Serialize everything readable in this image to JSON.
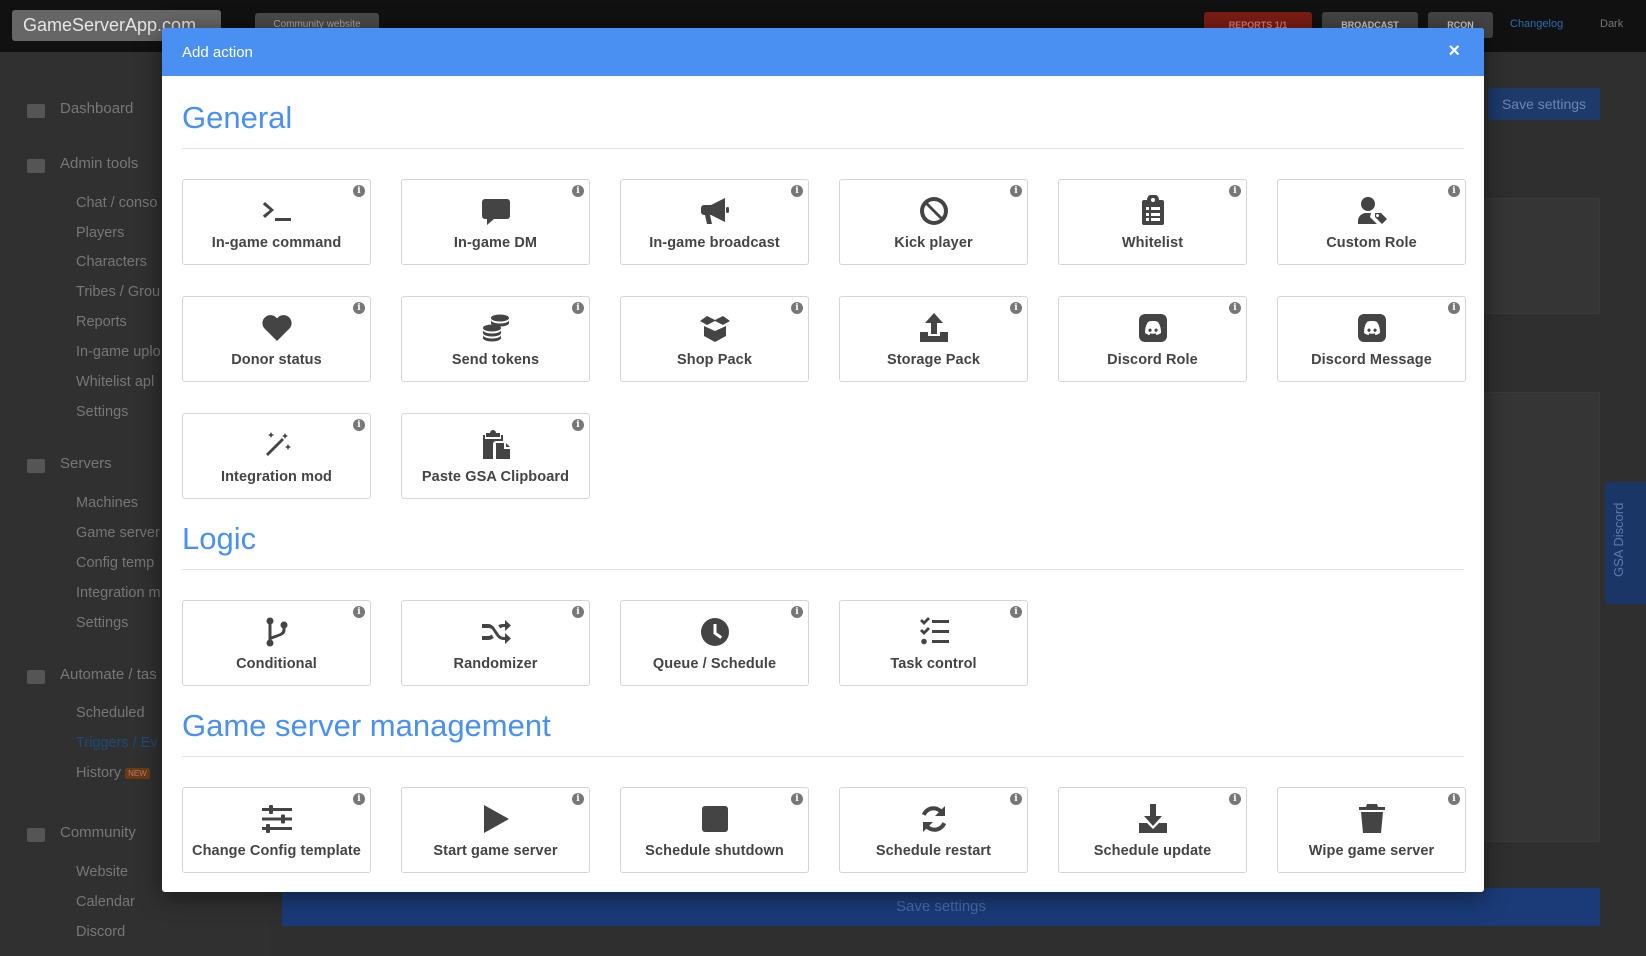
{
  "background": {
    "brand": "GameServerApp.com",
    "community_website": "Community website",
    "reports": "REPORTS 1/1",
    "broadcast": "BROADCAST",
    "rcon": "RCON",
    "changelog": "Changelog",
    "dark": "Dark",
    "save_settings_top": "Save settings",
    "save_settings_bottom": "Save settings",
    "gsa_discord": "GSA Discord",
    "sidebar": {
      "dashboard": "Dashboard",
      "admin_tools": "Admin tools",
      "admin_items": [
        "Chat / conso",
        "Players",
        "Characters",
        "Tribes / Grou",
        "Reports",
        "In-game uplo",
        "Whitelist apl",
        "Settings"
      ],
      "servers": "Servers",
      "server_items": [
        "Machines",
        "Game server",
        "Config temp",
        "Integration m",
        "Settings"
      ],
      "automate": "Automate / tas",
      "automate_items": [
        "Scheduled",
        "Triggers / Ev",
        "History"
      ],
      "history_badge": "NEW",
      "community": "Community",
      "community_items": [
        "Website",
        "Calendar",
        "Discord"
      ]
    }
  },
  "modal": {
    "title": "Add action",
    "close": "×",
    "sections": [
      {
        "title": "General",
        "items": [
          {
            "label": "In-game command",
            "icon": "terminal-icon"
          },
          {
            "label": "In-game DM",
            "icon": "comment-icon"
          },
          {
            "label": "In-game broadcast",
            "icon": "bullhorn-icon"
          },
          {
            "label": "Kick player",
            "icon": "ban-icon"
          },
          {
            "label": "Whitelist",
            "icon": "clipboard-list-icon"
          },
          {
            "label": "Custom Role",
            "icon": "user-tag-icon"
          },
          {
            "label": "Donor status",
            "icon": "heart-icon"
          },
          {
            "label": "Send tokens",
            "icon": "coins-icon"
          },
          {
            "label": "Shop Pack",
            "icon": "box-open-icon"
          },
          {
            "label": "Storage Pack",
            "icon": "upload-icon"
          },
          {
            "label": "Discord Role",
            "icon": "discord-icon"
          },
          {
            "label": "Discord Message",
            "icon": "discord-icon"
          },
          {
            "label": "Integration mod",
            "icon": "magic-wand-icon"
          },
          {
            "label": "Paste GSA Clipboard",
            "icon": "paste-icon"
          }
        ]
      },
      {
        "title": "Logic",
        "items": [
          {
            "label": "Conditional",
            "icon": "code-branch-icon"
          },
          {
            "label": "Randomizer",
            "icon": "random-icon"
          },
          {
            "label": "Queue / Schedule",
            "icon": "clock-icon"
          },
          {
            "label": "Task control",
            "icon": "tasks-icon"
          }
        ]
      },
      {
        "title": "Game server management",
        "items": [
          {
            "label": "Change Config template",
            "icon": "sliders-icon"
          },
          {
            "label": "Start game server",
            "icon": "play-icon"
          },
          {
            "label": "Schedule shutdown",
            "icon": "stop-icon"
          },
          {
            "label": "Schedule restart",
            "icon": "sync-icon"
          },
          {
            "label": "Schedule update",
            "icon": "download-icon"
          },
          {
            "label": "Wipe game server",
            "icon": "trash-icon"
          }
        ]
      }
    ]
  }
}
